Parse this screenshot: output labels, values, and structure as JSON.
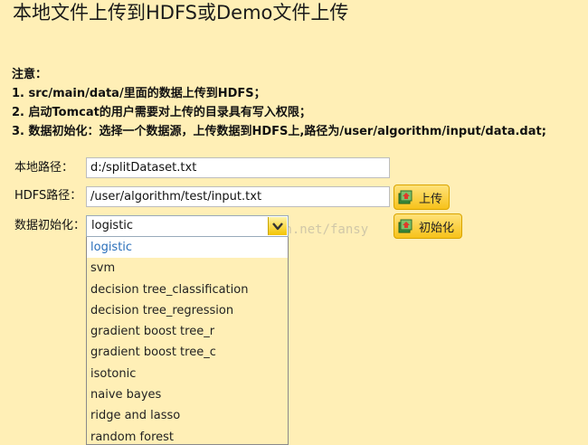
{
  "page": {
    "title": "本地文件上传到HDFS或Demo文件上传"
  },
  "notes": {
    "heading": "注意：",
    "items": [
      "1. src/main/data/里面的数据上传到HDFS；",
      "2. 启动Tomcat的用户需要对上传的目录具有写入权限；",
      "3. 数据初始化：选择一个数据源，上传数据到HDFS上,路径为/user/algorithm/input/data.dat;"
    ]
  },
  "form": {
    "local_path": {
      "label": "本地路径：",
      "value": "d:/splitDataset.txt"
    },
    "hdfs_path": {
      "label": "HDFS路径：",
      "value": "/user/algorithm/test/input.txt"
    },
    "upload_button": {
      "label": "上传",
      "icon": "upload-icon"
    },
    "data_init": {
      "label": "数据初始化：",
      "selected": "logistic",
      "options": [
        "logistic",
        "svm",
        "decision tree_classification",
        "decision tree_regression",
        "gradient boost tree_r",
        "gradient boost tree_c",
        "isotonic",
        "naive bayes",
        "ridge and lasso",
        "random forest"
      ]
    },
    "init_button": {
      "label": "初始化",
      "icon": "init-icon"
    }
  },
  "watermark": "http://blog.csdn.net/fansy",
  "colors": {
    "background": "#FFEFB6",
    "button": "#F7C21A",
    "selected_option_text": "#2A6FBA"
  }
}
